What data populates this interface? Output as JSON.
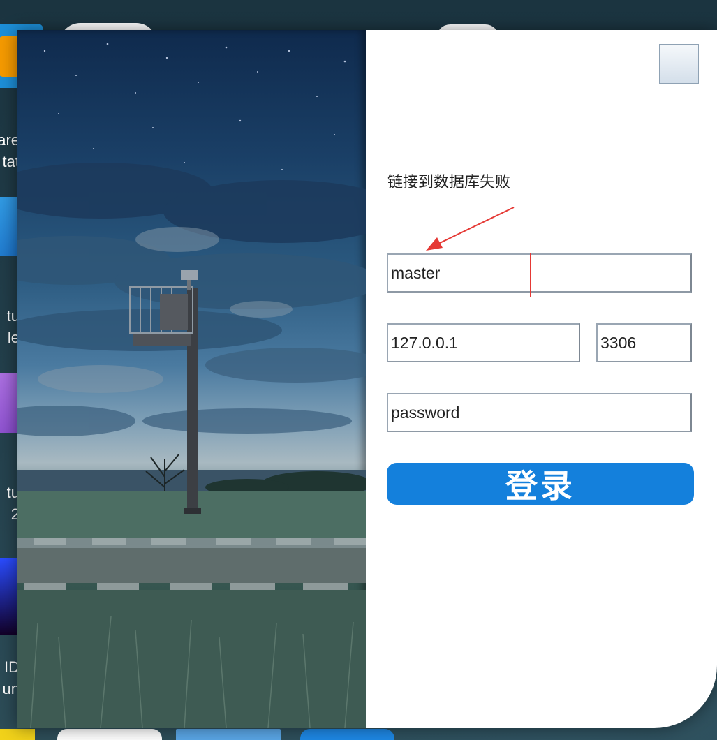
{
  "desktop": {
    "icons": [
      {
        "name": "vmware-workstation",
        "line1": "are",
        "line2": "tat"
      },
      {
        "name": "visual-studio-code",
        "line1": "tu",
        "line2": "le"
      },
      {
        "name": "visual-studio-2022",
        "line1": "tu",
        "line2": "2"
      },
      {
        "name": "dev-app",
        "line1": "ID",
        "line2": "un"
      }
    ]
  },
  "dialog": {
    "status_message": "链接到数据库失败",
    "fields": {
      "username": "master",
      "host": "127.0.0.1",
      "port": "3306",
      "password": "password"
    },
    "login_button": "登录"
  },
  "colors": {
    "accent": "#1480dc",
    "highlight": "#e53935"
  }
}
